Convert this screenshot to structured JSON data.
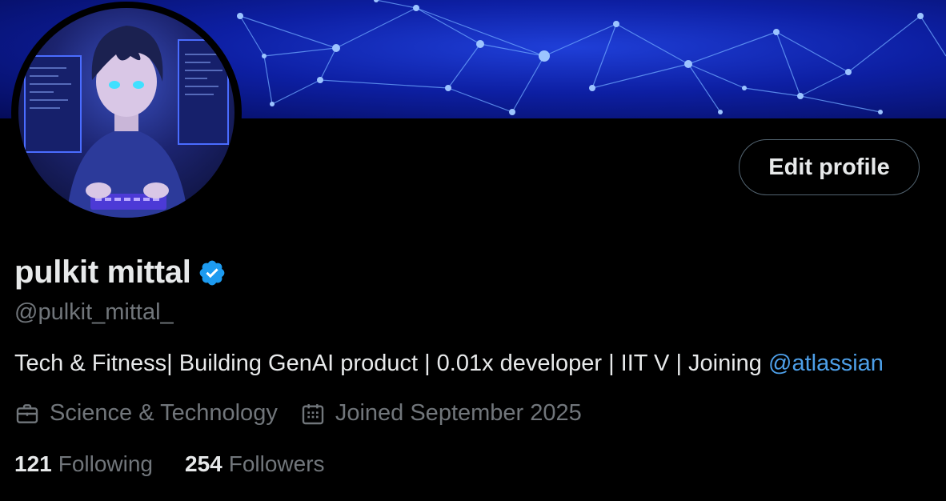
{
  "profile": {
    "display_name": "pulkit mittal",
    "handle": "@pulkit_mittal_",
    "verified": true,
    "bio_text": "Tech & Fitness| Building GenAI product | 0.01x developer | IIT V | Joining ",
    "bio_mention": "@atlassian",
    "category": "Science & Technology",
    "joined": "Joined September 2025"
  },
  "actions": {
    "edit_profile_label": "Edit profile"
  },
  "stats": {
    "following_count": "121",
    "following_label": "Following",
    "followers_count": "254",
    "followers_label": "Followers"
  },
  "colors": {
    "background": "#000000",
    "primary_text": "#e7e9ea",
    "secondary_text": "#71767b",
    "link": "#4d9fe8",
    "verified_badge": "#1d9bf0",
    "button_border": "#536471"
  },
  "icons": {
    "verified": "verified-badge-icon",
    "category": "briefcase-icon",
    "joined": "calendar-icon"
  }
}
